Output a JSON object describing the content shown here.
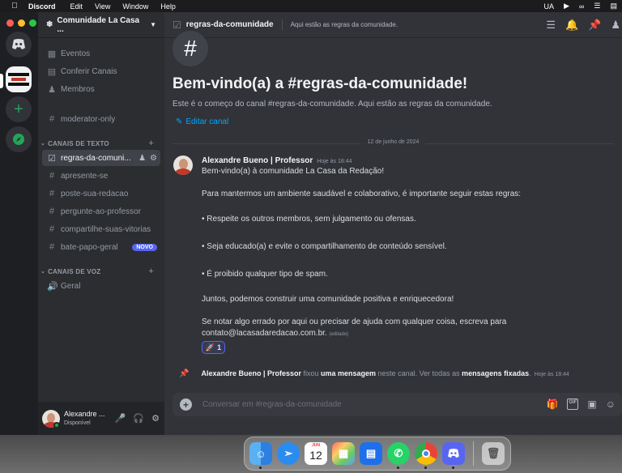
{
  "menubar": {
    "app_name": "Discord",
    "menus": [
      "Edit",
      "View",
      "Window",
      "Help"
    ],
    "input_locale": "UA"
  },
  "guild": {
    "name": "Comunidade La Casa ..."
  },
  "sidebar": {
    "top_items": [
      {
        "label": "Eventos",
        "icon": "calendar-icon"
      },
      {
        "label": "Conferir Canais",
        "icon": "channels-browse-icon"
      },
      {
        "label": "Membros",
        "icon": "members-icon"
      }
    ],
    "standalone_channel": "moderator-only",
    "text_category": "CANAIS DE TEXTO",
    "text_channels": [
      {
        "label": "regras-da-comuni...",
        "active": true
      },
      {
        "label": "apresente-se"
      },
      {
        "label": "poste-sua-redacao"
      },
      {
        "label": "pergunte-ao-professor"
      },
      {
        "label": "compartilhe-suas-vitorias"
      },
      {
        "label": "bate-papo-geral",
        "badge": "NOVO"
      }
    ],
    "voice_category": "CANAIS DE VOZ",
    "voice_channels": [
      {
        "label": "Geral"
      }
    ]
  },
  "user": {
    "name": "Alexandre ...",
    "status": "Disponível"
  },
  "channel": {
    "name": "regras-da-comunidade",
    "topic": "Aqui estão as regras da comunidade."
  },
  "welcome": {
    "hash": "#",
    "title": "Bem-vindo(a) a #regras-da-comunidade!",
    "subtitle": "Este é o começo do canal #regras-da-comunidade. Aqui estão as regras da comunidade.",
    "edit_label": "Editar canal"
  },
  "date_divider": "12 de junho de 2024",
  "message": {
    "author": "Alexandre Bueno | Professor",
    "timestamp": "Hoje às 18:44",
    "lines": [
      "Bem-vindo(a) à comunidade La Casa da Redação!",
      "Para mantermos um ambiente saudável e colaborativo, é importante seguir estas regras:",
      "•  Respeite os outros membros, sem julgamento ou ofensas.",
      "•  Seja educado(a) e evite o compartilhamento de conteúdo sensível.",
      "•  É proibido qualquer tipo de spam.",
      "Juntos, podemos construir uma comunidade positiva e enriquecedora!",
      "Se notar algo errado por aqui ou precisar de ajuda com qualquer coisa, escreva para",
      "contato@lacasadaredacao.com.br."
    ],
    "edited": "(editado)",
    "reaction": {
      "emoji": "🚀",
      "count": "1"
    }
  },
  "pin_notice": {
    "author": "Alexandre Bueno | Professor",
    "text1": " fixou ",
    "link1": "uma mensagem",
    "text2": " neste canal. Ver todas as ",
    "link2": "mensagens fixadas",
    "text3": ".",
    "timestamp": "Hoje às 18:44"
  },
  "composer": {
    "placeholder": "Conversar em #regras-da-comunidade",
    "gif_label": "GIF"
  },
  "dock": {
    "calendar_month": "JUN",
    "calendar_day": "12"
  },
  "colors": {
    "accent": "#5865f2",
    "online": "#23a55a",
    "link": "#00a8fc"
  }
}
